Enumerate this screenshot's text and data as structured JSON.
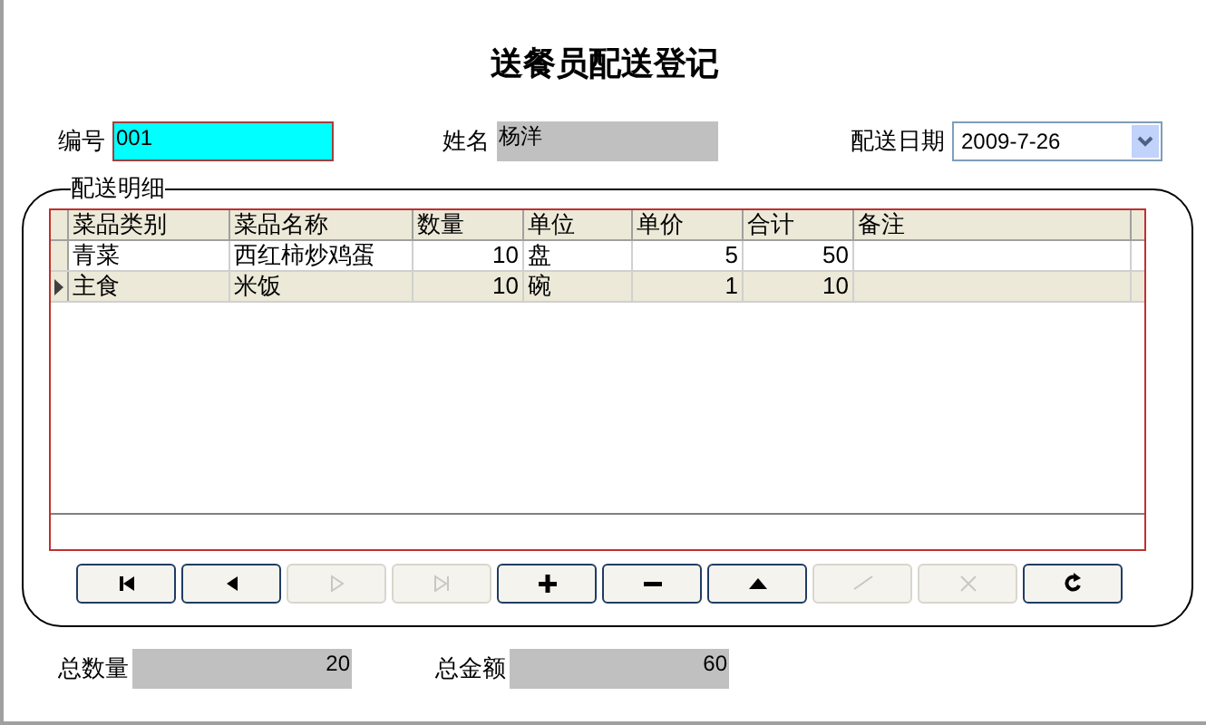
{
  "title": "送餐员配送登记",
  "fields": [
    {
      "label": "编号",
      "value": "001",
      "kind": "highlight"
    },
    {
      "label": "姓名",
      "value": "杨洋",
      "kind": "readonly"
    },
    {
      "label": "配送日期",
      "value": "2009-7-26",
      "kind": "date"
    }
  ],
  "group": {
    "title": "配送明细",
    "table": {
      "columns": [
        {
          "label": "菜品类别",
          "numeric": false
        },
        {
          "label": "菜品名称",
          "numeric": false
        },
        {
          "label": "数量",
          "numeric": true
        },
        {
          "label": "单位",
          "numeric": false
        },
        {
          "label": "单价",
          "numeric": true
        },
        {
          "label": "合计",
          "numeric": true
        },
        {
          "label": "备注"
        }
      ],
      "rows": [
        {
          "selected": false,
          "cells": [
            "青菜",
            "西红柿炒鸡蛋",
            "10",
            "盘",
            "5",
            "50",
            ""
          ]
        },
        {
          "selected": true,
          "cells": [
            "主食",
            "米饭",
            "10",
            "碗",
            "1",
            "10",
            ""
          ]
        }
      ]
    },
    "navigator": [
      {
        "kind": "first",
        "disabled": false
      },
      {
        "kind": "prior",
        "disabled": false
      },
      {
        "kind": "next",
        "disabled": true
      },
      {
        "kind": "last",
        "disabled": true
      },
      {
        "kind": "insert",
        "disabled": false
      },
      {
        "kind": "delete",
        "disabled": false
      },
      {
        "kind": "edit",
        "disabled": false
      },
      {
        "kind": "post",
        "disabled": true
      },
      {
        "kind": "cancel",
        "disabled": true
      },
      {
        "kind": "refresh",
        "disabled": false
      }
    ]
  },
  "totals": [
    {
      "label": "总数量",
      "value": "20"
    },
    {
      "label": "总金额",
      "value": "60"
    }
  ]
}
